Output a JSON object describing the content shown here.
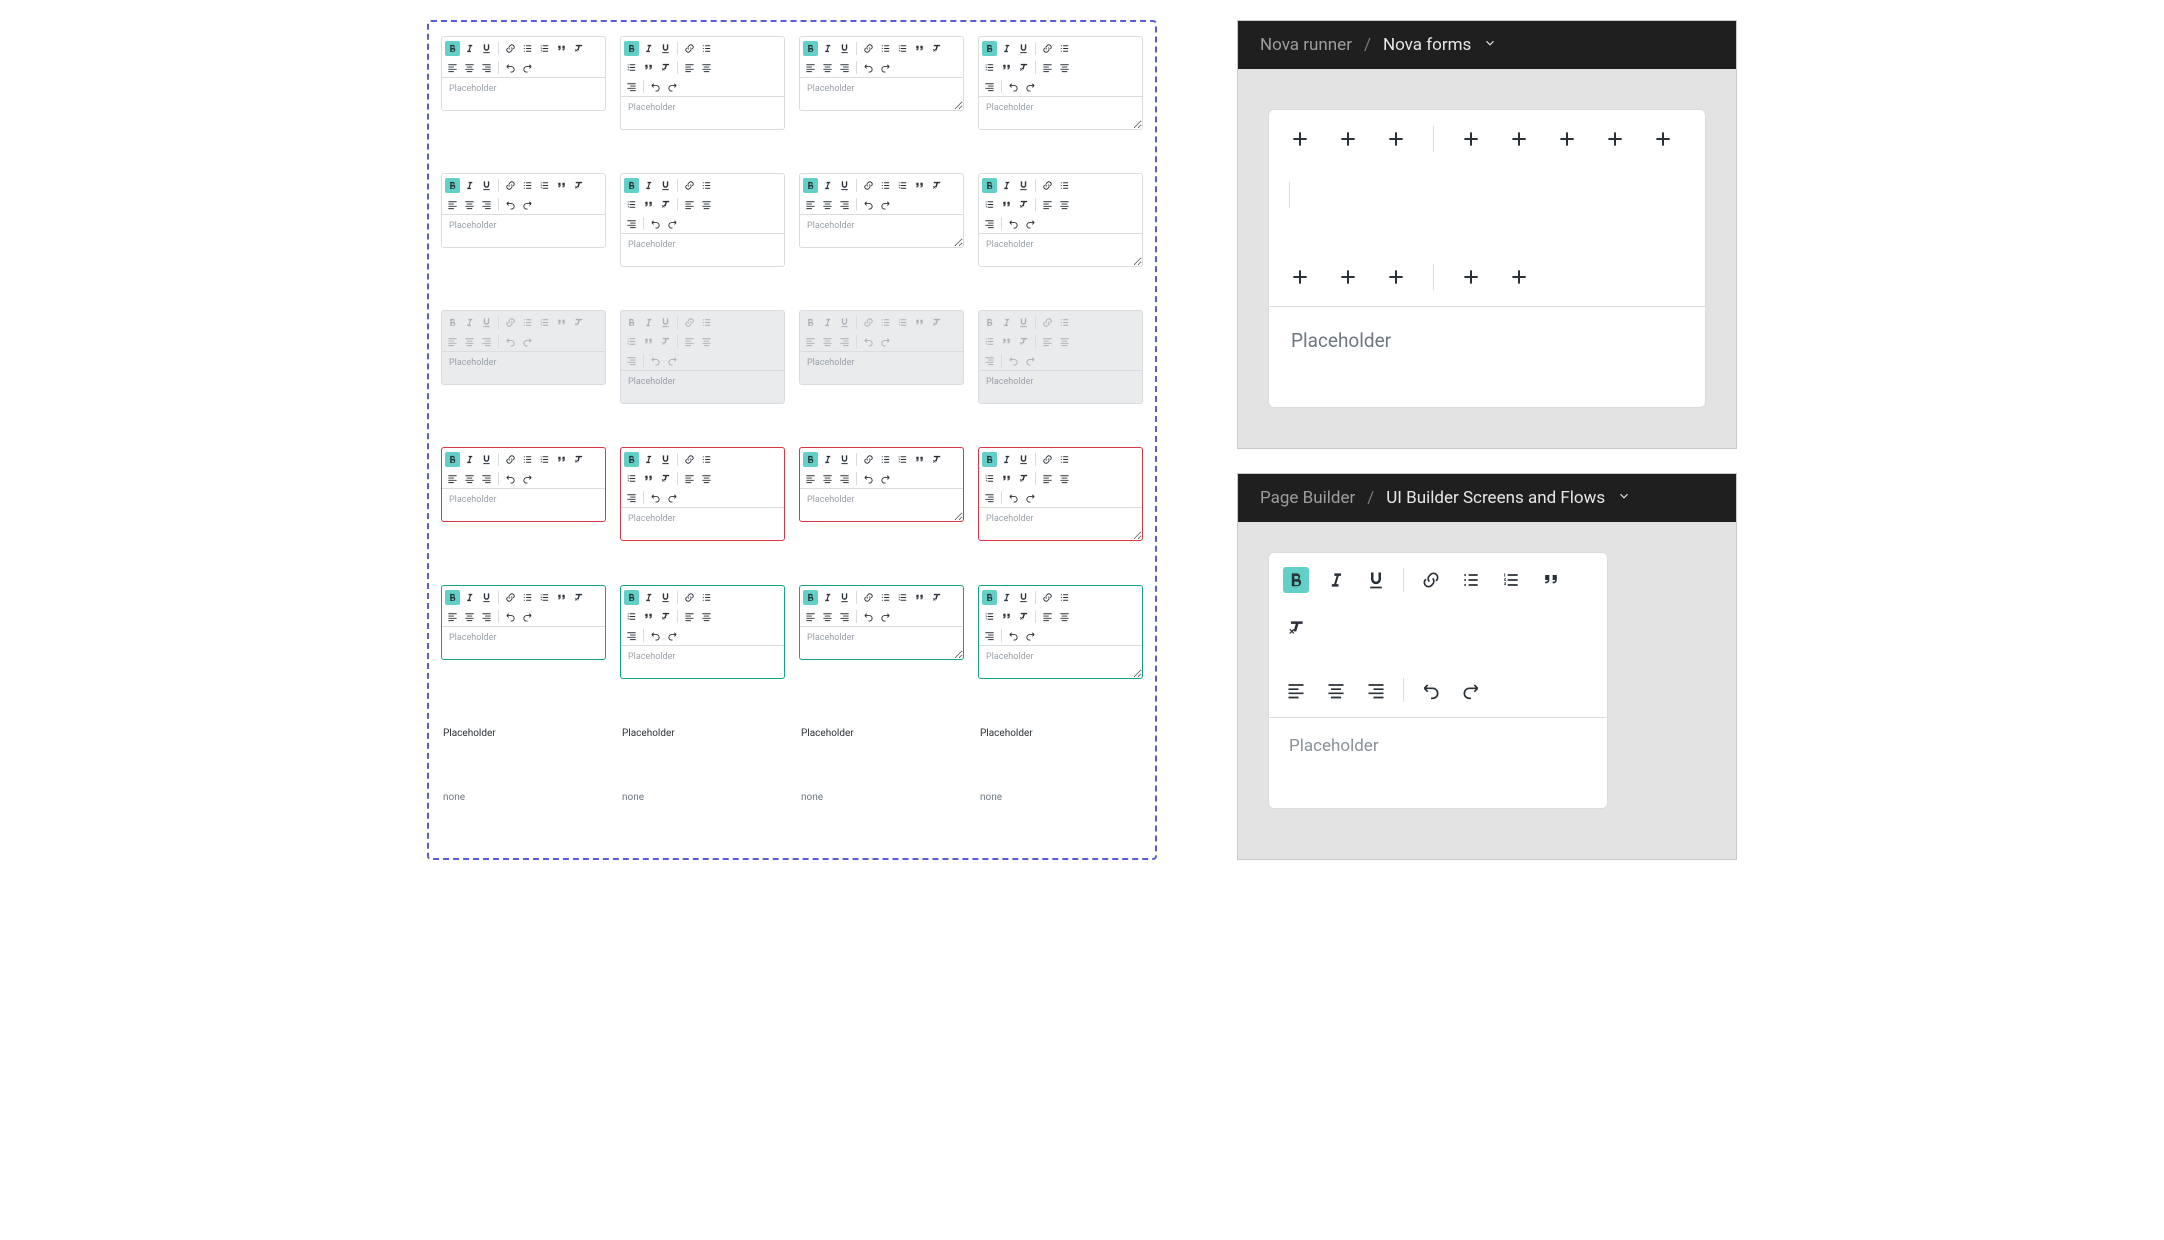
{
  "placeholder": "Placeholder",
  "none_label": "none",
  "preview_nova": {
    "app": "Nova runner",
    "page": "Nova forms"
  },
  "preview_ui": {
    "app": "Page Builder",
    "page": "UI Builder Screens and Flows"
  },
  "variants": {
    "full": [
      "bold",
      "italic",
      "underline",
      "sep",
      "link",
      "ul",
      "ol",
      "quote",
      "clear",
      "row",
      "al",
      "ac",
      "ar",
      "sep",
      "undo",
      "redo"
    ],
    "stack": [
      "bold",
      "italic",
      "underline",
      "sep",
      "link",
      "ul",
      "row",
      "ol",
      "quote",
      "clear",
      "sep",
      "al",
      "ac",
      "row",
      "ar",
      "sep",
      "undo",
      "redo"
    ],
    "fullR": [
      "bold",
      "italic",
      "underline",
      "sep",
      "link",
      "ul",
      "ol",
      "quote",
      "clear",
      "row",
      "al",
      "ac",
      "ar",
      "sep",
      "undo",
      "redo"
    ],
    "stackR": [
      "bold",
      "italic",
      "underline",
      "sep",
      "link",
      "ul",
      "row",
      "ol",
      "quote",
      "clear",
      "sep",
      "al",
      "ac",
      "row",
      "ar",
      "sep",
      "undo",
      "redo"
    ]
  },
  "ui_toolbar": [
    "bold",
    "italic",
    "underline",
    "sep",
    "link",
    "ul",
    "ol",
    "quote",
    "clear",
    "row",
    "al",
    "ac",
    "ar",
    "sep",
    "undo",
    "redo"
  ],
  "grid": [
    {
      "state": "default",
      "variant": "full",
      "resize": false
    },
    {
      "state": "default",
      "variant": "stack",
      "resize": false
    },
    {
      "state": "default",
      "variant": "fullR",
      "resize": true
    },
    {
      "state": "default",
      "variant": "stackR",
      "resize": true
    },
    {
      "state": "default",
      "variant": "full",
      "resize": false
    },
    {
      "state": "default",
      "variant": "stack",
      "resize": false
    },
    {
      "state": "default",
      "variant": "fullR",
      "resize": true
    },
    {
      "state": "default",
      "variant": "stackR",
      "resize": true
    },
    {
      "state": "disabled",
      "variant": "full",
      "resize": false
    },
    {
      "state": "disabled",
      "variant": "stack",
      "resize": false
    },
    {
      "state": "disabled",
      "variant": "fullR",
      "resize": false
    },
    {
      "state": "disabled",
      "variant": "stackR",
      "resize": false
    },
    {
      "state": "error",
      "variant": "full",
      "resize": false
    },
    {
      "state": "error",
      "variant": "stack",
      "resize": false
    },
    {
      "state": "error",
      "variant": "fullR",
      "resize": true
    },
    {
      "state": "error",
      "variant": "stackR",
      "resize": true
    },
    {
      "state": "success",
      "variant": "full",
      "resize": false
    },
    {
      "state": "success",
      "variant": "stack",
      "resize": false
    },
    {
      "state": "success",
      "variant": "fullR",
      "resize": true
    },
    {
      "state": "success",
      "variant": "stackR",
      "resize": true
    }
  ]
}
